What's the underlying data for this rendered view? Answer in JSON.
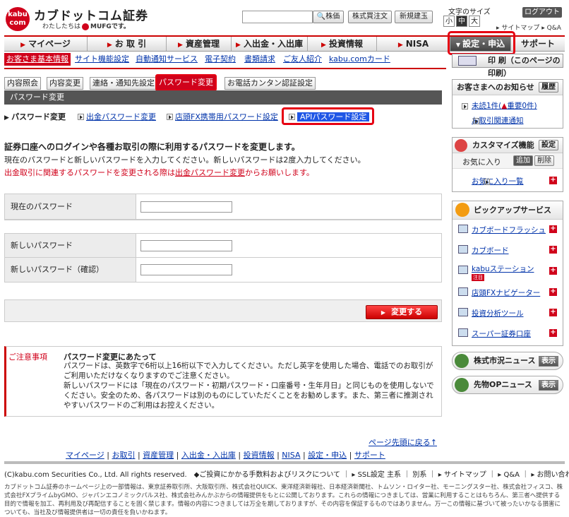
{
  "header": {
    "logo_badge": "kabu com",
    "brand_name": "カブドットコム証券",
    "brand_sub": "わたしたちは",
    "brand_mufg": "MUFGです。",
    "search_placeholder": "",
    "btn_stock": "株価",
    "btn_order": "株式買注文",
    "btn_new": "新規建玉",
    "font_size_label": "文字のサイズ",
    "font_small": "小",
    "font_mid": "中",
    "font_large": "大",
    "logout": "ログアウト",
    "sitemap": "▸ サイトマップ ▸ Q&A"
  },
  "nav": {
    "items": [
      "マイページ",
      "お 取 引",
      "資産管理",
      "入出金・入出庫",
      "投資情報",
      "NISA",
      "設定・申込",
      "サポート"
    ]
  },
  "subnav": {
    "items": [
      "お客さま基本情報",
      "サイト機能設定",
      "自動通知サービス",
      "電子契約",
      "書類請求",
      "ご友人紹介",
      "kabu.comカード"
    ]
  },
  "tabs": {
    "items": [
      "内容照会",
      "内容変更",
      "連絡・通知先設定",
      "パスワード変更",
      "お電話カンタン認証設定"
    ]
  },
  "section_title": "パスワード変更",
  "links": {
    "current": "パスワード変更",
    "withdraw": "出金パスワード変更",
    "fx": "店頭FX携帯用パスワード設定",
    "api": "APIパスワード設定"
  },
  "intro": {
    "line1": "証券口座へのログインや各種お取引の際に利用するパスワードを変更します。",
    "line2": "現在のパスワードと新しいパスワードを入力してください。新しいパスワードは2度入力してください。",
    "line3_pre": "出金取引に関連するパスワードを変更される際は",
    "line3_link": "出金パスワード変更",
    "line3_post": "からお願いします。"
  },
  "form": {
    "current_pw_label": "現在のパスワード",
    "new_pw_label": "新しいパスワード",
    "confirm_pw_label": "新しいパスワード（確認）",
    "submit": "変更する"
  },
  "notice": {
    "title": "ご注意事項",
    "heading": "パスワード変更にあたって",
    "body1": "パスワードは、英数字で6桁以上16桁以下で入力してください。ただし英字を使用した場合、電話でのお取引がご利用いただけなくなりますのでご注意ください。",
    "body2": "新しいパスワードには「現在のパスワード・初期パスワード・口座番号・生年月日」と同じものを使用しないでください。安全のため、各パスワードは別のものにしていただくことをお勧めします。また、第三者に推測されやすいパスワードのご利用はお控えください。"
  },
  "page_top": "ページ先頭に戻る↑",
  "footer_nav": [
    "マイページ",
    "お取引",
    "資産管理",
    "入出金・入出庫",
    "投資情報",
    "NISA",
    "設定・申込",
    "サポート"
  ],
  "copyright": "(C)kabu.com Securities Co., Ltd. All rights reserved.　◆ご投資にかかる手数料およびリスクについて ｜ ▸ SSL設定 主系 ｜ 別系 ｜ ▸ サイトマップ ｜ ▸ Q&A ｜ ▸ お問い合わせ",
  "disclaimer": "カブドットコム証券のホームページ上の一部情報は、東京証券取引所、大阪取引所、株式会社QUICK、東洋経済新報社、日本経済新聞社、トムソン・ロイター社、モーニングスター社、株式会社フィスコ、株式会社FXプライムbyGMO、ジャパンエコノミックパルス社、株式会社みんかぶからの情報提供をもとに公開しております。これらの情報につきましては、営業に利用することはもちろん、第三者へ提供する目的で情報を加工、再利用及び再配信することを固く禁じます。情報の内容につきましては万全を期しておりますが、その内容を保証するものではありません。万一この情報に基づいて被ったいかなる損害についても、当社及び情報提供者は一切の責任を負いかねます。",
  "sidebar": {
    "print": "印 刷（このページの印刷）",
    "notice_title": "お客さまへのお知らせ",
    "history": "履歴",
    "unread": "未読1件(",
    "important": "重要0件)",
    "trade_notice": "お取引関連通知",
    "custom_title": "カスタマイズ機能",
    "custom_setting": "設定",
    "fav": "お気に入り",
    "add": "追加",
    "del": "削除",
    "fav_list": "お気に入り一覧",
    "pickup_title": "ピックアップサービス",
    "pickup": [
      "カブボードフラッシュ",
      "カブボード",
      "kabuステーション",
      "店頭FXナビゲーター",
      "投資分析ツール",
      "スーパー証券口座"
    ],
    "new_badge": "注目",
    "market_news": "株式市況ニュース",
    "op_news": "先物OPニュース",
    "show": "表示"
  },
  "colors": {
    "brand_red": "#d0021b",
    "highlight": "#e60012",
    "api_blue": "#1e56e6"
  }
}
